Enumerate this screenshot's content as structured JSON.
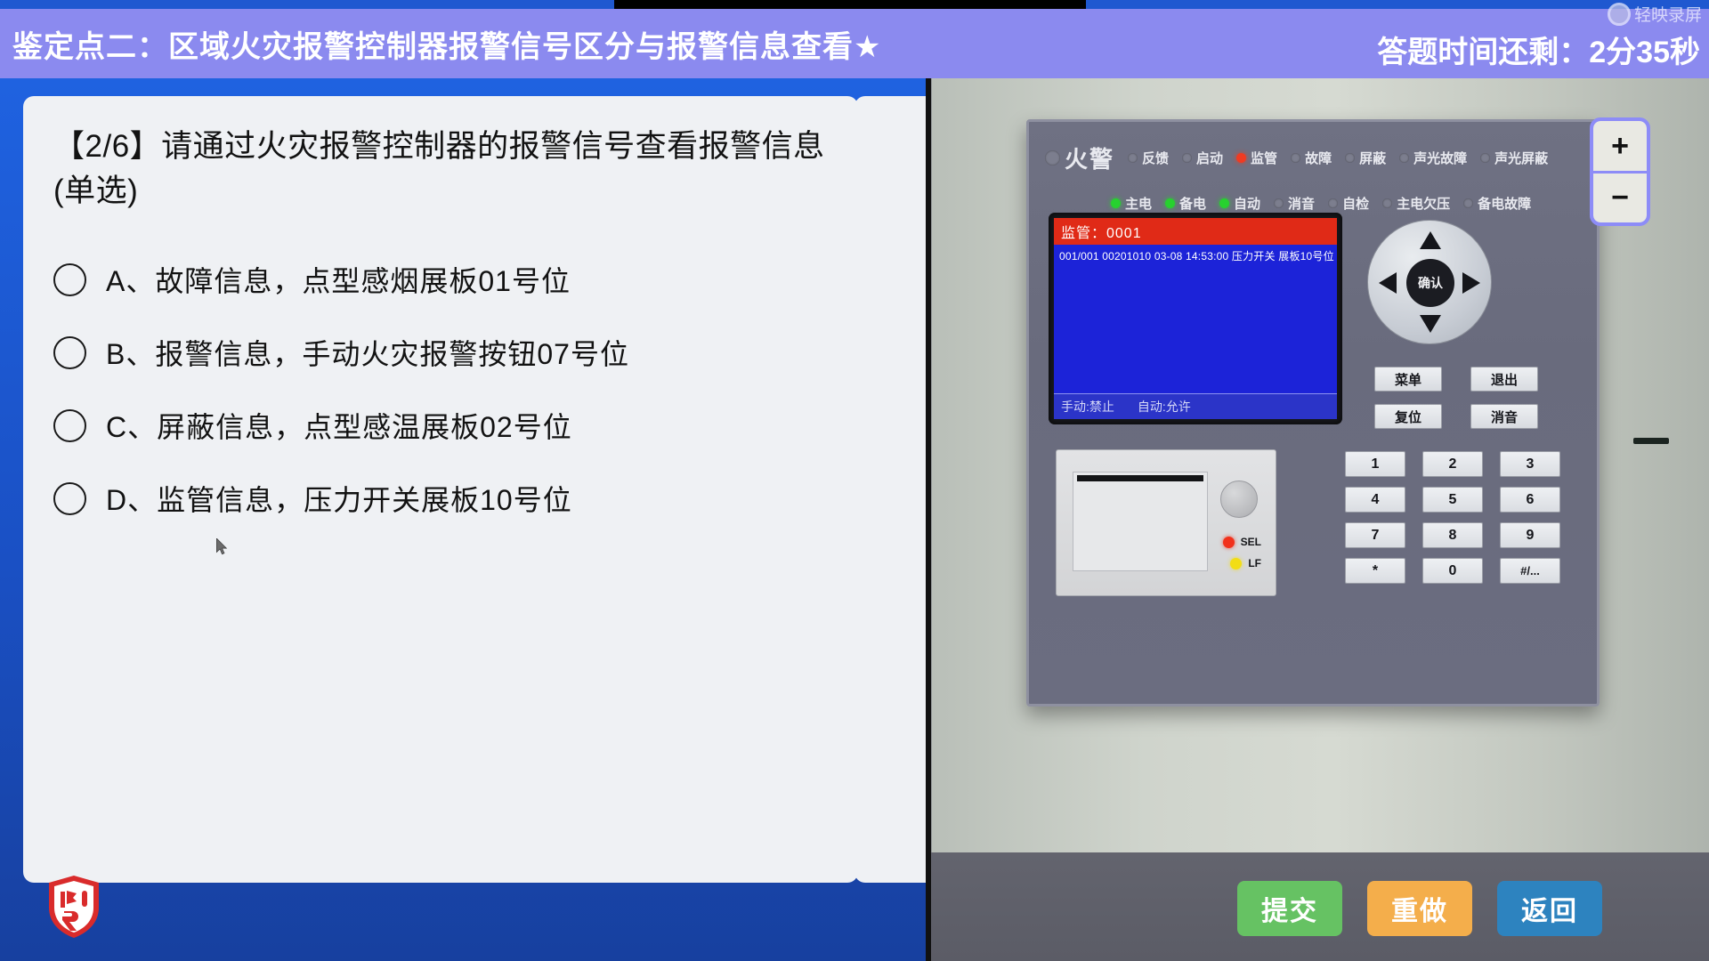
{
  "header": {
    "title": "鉴定点二：区域火灾报警控制器报警信号区分与报警信息查看★",
    "timer": "答题时间还剩：2分35秒",
    "watermark": "轻映录屏"
  },
  "question": {
    "text": "【2/6】请通过火灾报警控制器的报警信号查看报警信息(单选)",
    "options": [
      {
        "label": "A、故障信息，点型感烟展板01号位",
        "selected": false
      },
      {
        "label": "B、报警信息，手动火灾报警按钮07号位",
        "selected": false
      },
      {
        "label": "C、屏蔽信息，点型感温展板02号位",
        "selected": false
      },
      {
        "label": "D、监管信息，压力开关展板10号位",
        "selected": false
      }
    ]
  },
  "panel": {
    "indicators_row1": [
      {
        "label": "火警",
        "state": "off",
        "major": true
      },
      {
        "label": "反馈",
        "state": "off"
      },
      {
        "label": "启动",
        "state": "off"
      },
      {
        "label": "监管",
        "state": "red"
      },
      {
        "label": "故障",
        "state": "off"
      },
      {
        "label": "屏蔽",
        "state": "off"
      },
      {
        "label": "声光故障",
        "state": "off"
      },
      {
        "label": "声光屏蔽",
        "state": "off"
      }
    ],
    "indicators_row2": [
      {
        "label": "主电",
        "state": "green"
      },
      {
        "label": "备电",
        "state": "green"
      },
      {
        "label": "自动",
        "state": "green"
      },
      {
        "label": "消音",
        "state": "off"
      },
      {
        "label": "自检",
        "state": "off"
      },
      {
        "label": "主电欠压",
        "state": "off"
      },
      {
        "label": "备电故障",
        "state": "off"
      }
    ],
    "lcd": {
      "title": "监管：0001",
      "line1": "001/001 00201010  03-08 14:53:00  压力开关 展板10号位",
      "status_manual": "手动:禁止",
      "status_auto": "自动:允许"
    },
    "dpad_center": "确认",
    "function_buttons": [
      "菜单",
      "退出",
      "复位",
      "消音"
    ],
    "keypad": [
      "1",
      "2",
      "3",
      "4",
      "5",
      "6",
      "7",
      "8",
      "9",
      "*",
      "0",
      "#/..."
    ],
    "printer_leds": [
      {
        "label": "SEL",
        "color": "red"
      },
      {
        "label": "LF",
        "color": "yellow"
      }
    ]
  },
  "zoom_controls": {
    "in": "+",
    "out": "−"
  },
  "actions": [
    {
      "label": "提交",
      "kind": "submit",
      "color": "#66c263"
    },
    {
      "label": "重做",
      "kind": "redo",
      "color": "#f4ae4b"
    },
    {
      "label": "返回",
      "kind": "back",
      "color": "#2d83bf"
    }
  ]
}
